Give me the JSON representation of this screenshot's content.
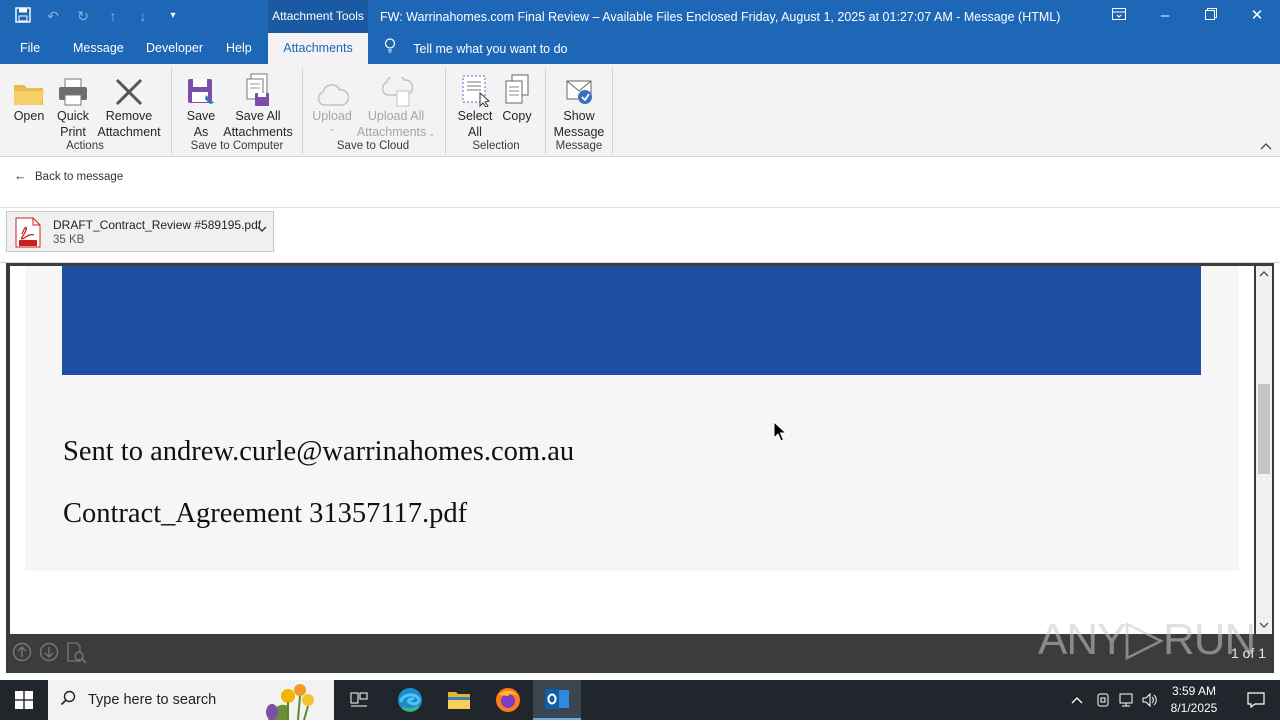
{
  "titlebar": {
    "context_tab": "Attachment Tools",
    "title": "FW: Warrinahomes.com Final Review – Available Files Enclosed Friday, August 1, 2025 at 01:27:07 AM  -  Message (HTML)",
    "qat_icons": [
      "save-icon",
      "undo-icon",
      "redo-icon",
      "up-arrow-icon",
      "down-arrow-icon",
      "customize-icon"
    ],
    "win_icons": [
      "ribbon-display-icon",
      "minimize-icon",
      "restore-icon",
      "close-icon"
    ]
  },
  "menu": {
    "tabs": [
      "File",
      "Message",
      "Developer",
      "Help",
      "Attachments"
    ],
    "tell": "Tell me what you want to do"
  },
  "ribbon": {
    "buttons": {
      "open": "Open",
      "quick_print_1": "Quick",
      "quick_print_2": "Print",
      "remove_1": "Remove",
      "remove_2": "Attachment",
      "save_as_1": "Save",
      "save_as_2": "As",
      "save_all_1": "Save All",
      "save_all_2": "Attachments",
      "upload": "Upload",
      "upload_all_1": "Upload All",
      "upload_all_2": "Attachments",
      "select_all_1": "Select",
      "select_all_2": "All",
      "copy": "Copy",
      "show_message_1": "Show",
      "show_message_2": "Message"
    },
    "groups": [
      "Actions",
      "Save to Computer",
      "Save to Cloud",
      "Selection",
      "Message"
    ]
  },
  "back": {
    "label": "Back to message"
  },
  "attachment": {
    "name": "DRAFT_Contract_Review #589195.pdf",
    "size": "35 KB"
  },
  "document": {
    "sent_to": "Sent to andrew.curle@warrinahomes.com.au",
    "contract_file": "Contract_Agreement 31357117.pdf",
    "banner_color": "#1f4fa5"
  },
  "viewer": {
    "page_count": "1 of 1"
  },
  "watermark": {
    "text_left": "ANY",
    "text_right": "RUN"
  },
  "taskbar": {
    "search_placeholder": "Type here to search",
    "apps": [
      "task-view-icon",
      "edge-icon",
      "file-explorer-icon",
      "firefox-icon",
      "outlook-icon"
    ],
    "time": "3:59 AM",
    "date": "8/1/2025"
  }
}
